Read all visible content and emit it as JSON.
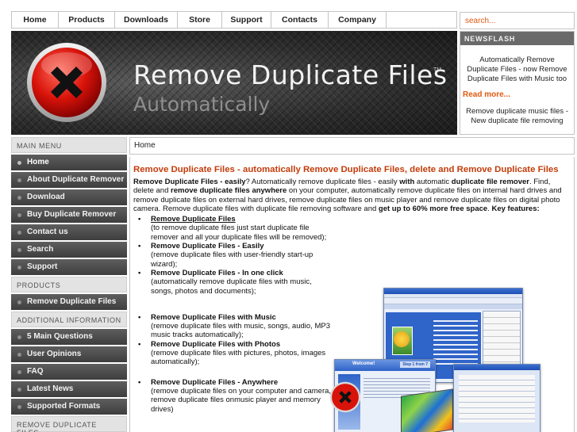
{
  "nav": {
    "items": [
      "Home",
      "Products",
      "Downloads",
      "Store",
      "Support",
      "Contacts",
      "Company"
    ]
  },
  "search": {
    "placeholder": "search..."
  },
  "banner": {
    "title": "Remove Duplicate Files",
    "tm": "TM",
    "subtitle": "Automatically",
    "logo_icon": "red-x-circle-icon"
  },
  "newsflash": {
    "heading": "NEWSFLASH",
    "text": "Automatically Remove Duplicate Files - now Remove Duplicate Files with Music too",
    "read_more": "Read more...",
    "text2": "Remove duplicate music files - New duplicate file removing"
  },
  "sidebar": {
    "main_menu_heading": "MAIN MENU",
    "main_menu": [
      "Home",
      "About Duplicate Remover",
      "Download",
      "Buy Duplicate Remover",
      "Contact us",
      "Search",
      "Support"
    ],
    "products_heading": "PRODUCTS",
    "products": [
      "Remove Duplicate Files"
    ],
    "additional_heading": "ADDITIONAL INFORMATION",
    "additional": [
      "5 Main Questions",
      "User Opinions",
      "FAQ",
      "Latest News",
      "Supported Formats"
    ],
    "remove_heading": "REMOVE DUPLICATE FILES"
  },
  "breadcrumb": "Home",
  "content": {
    "heading": "Remove Duplicate Files - automatically Remove Duplicate Files, delete and Remove Duplicate Files",
    "intro": {
      "p1b": "Remove Duplicate Files - easily",
      "p1": "? Automatically remove duplicate files - easily ",
      "p2b": "with",
      "p2": " automatic ",
      "p3b": "duplicate file remover",
      "p3": ". Find, delete and ",
      "p4b": "remove duplicate files anywhere",
      "p4": " on your computer, automatically remove duplicate files on internal hard drives and remove duplicate files on external hard drives, remove duplicate files on music player and remove duplicate files on digital photo camera. Remove duplicate files with duplicate file removing software and ",
      "p5b": "get up to 60% more free space",
      "p5": ".  ",
      "p6b": "Key features:"
    },
    "features": [
      {
        "title": "Remove Duplicate Files",
        "desc": "(to remove duplicate files just start duplicate file remover and all your duplicate files will be removed);"
      },
      {
        "title": "Remove Duplicate Files - Easily",
        "desc": "(remove duplicate files with user-friendly start-up wizard);"
      },
      {
        "title": "Remove Duplicate Files - In one click",
        "desc": "(automatically remove duplicate files with music, songs, photos and documents);"
      },
      {
        "title": "Remove Duplicate Files with Music",
        "desc": "(remove duplicate files with music, songs, audio, MP3 music tracks automatically);"
      },
      {
        "title": "Remove Duplicate Files with Photos",
        "desc": "(remove duplicate files with pictures, photos, images automatically);"
      },
      {
        "title": "Remove Duplicate Files - Anywhere",
        "desc": "(remove duplicate files on your computer and camera, remove duplicate files onmusic player and memory drives)"
      }
    ],
    "bullet": "•",
    "screenshot": {
      "welcome": "Welcome!",
      "step": "Step 1 from 7"
    }
  },
  "colors": {
    "accent_orange": "#e05a10",
    "heading_red": "#c43c0a",
    "sidebar_dark": "#4a4a4a"
  }
}
